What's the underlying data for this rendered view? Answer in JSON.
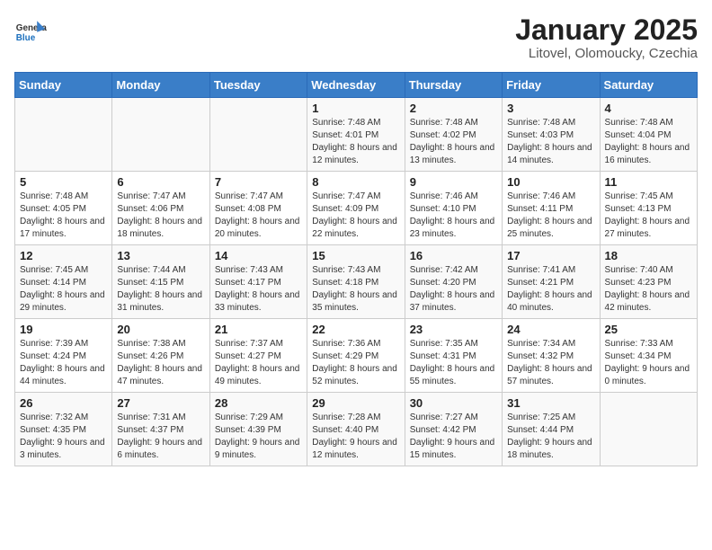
{
  "logo": {
    "general": "General",
    "blue": "Blue"
  },
  "title": "January 2025",
  "subtitle": "Litovel, Olomoucky, Czechia",
  "weekdays": [
    "Sunday",
    "Monday",
    "Tuesday",
    "Wednesday",
    "Thursday",
    "Friday",
    "Saturday"
  ],
  "weeks": [
    [
      {
        "day": "",
        "info": ""
      },
      {
        "day": "",
        "info": ""
      },
      {
        "day": "",
        "info": ""
      },
      {
        "day": "1",
        "info": "Sunrise: 7:48 AM\nSunset: 4:01 PM\nDaylight: 8 hours and 12 minutes."
      },
      {
        "day": "2",
        "info": "Sunrise: 7:48 AM\nSunset: 4:02 PM\nDaylight: 8 hours and 13 minutes."
      },
      {
        "day": "3",
        "info": "Sunrise: 7:48 AM\nSunset: 4:03 PM\nDaylight: 8 hours and 14 minutes."
      },
      {
        "day": "4",
        "info": "Sunrise: 7:48 AM\nSunset: 4:04 PM\nDaylight: 8 hours and 16 minutes."
      }
    ],
    [
      {
        "day": "5",
        "info": "Sunrise: 7:48 AM\nSunset: 4:05 PM\nDaylight: 8 hours and 17 minutes."
      },
      {
        "day": "6",
        "info": "Sunrise: 7:47 AM\nSunset: 4:06 PM\nDaylight: 8 hours and 18 minutes."
      },
      {
        "day": "7",
        "info": "Sunrise: 7:47 AM\nSunset: 4:08 PM\nDaylight: 8 hours and 20 minutes."
      },
      {
        "day": "8",
        "info": "Sunrise: 7:47 AM\nSunset: 4:09 PM\nDaylight: 8 hours and 22 minutes."
      },
      {
        "day": "9",
        "info": "Sunrise: 7:46 AM\nSunset: 4:10 PM\nDaylight: 8 hours and 23 minutes."
      },
      {
        "day": "10",
        "info": "Sunrise: 7:46 AM\nSunset: 4:11 PM\nDaylight: 8 hours and 25 minutes."
      },
      {
        "day": "11",
        "info": "Sunrise: 7:45 AM\nSunset: 4:13 PM\nDaylight: 8 hours and 27 minutes."
      }
    ],
    [
      {
        "day": "12",
        "info": "Sunrise: 7:45 AM\nSunset: 4:14 PM\nDaylight: 8 hours and 29 minutes."
      },
      {
        "day": "13",
        "info": "Sunrise: 7:44 AM\nSunset: 4:15 PM\nDaylight: 8 hours and 31 minutes."
      },
      {
        "day": "14",
        "info": "Sunrise: 7:43 AM\nSunset: 4:17 PM\nDaylight: 8 hours and 33 minutes."
      },
      {
        "day": "15",
        "info": "Sunrise: 7:43 AM\nSunset: 4:18 PM\nDaylight: 8 hours and 35 minutes."
      },
      {
        "day": "16",
        "info": "Sunrise: 7:42 AM\nSunset: 4:20 PM\nDaylight: 8 hours and 37 minutes."
      },
      {
        "day": "17",
        "info": "Sunrise: 7:41 AM\nSunset: 4:21 PM\nDaylight: 8 hours and 40 minutes."
      },
      {
        "day": "18",
        "info": "Sunrise: 7:40 AM\nSunset: 4:23 PM\nDaylight: 8 hours and 42 minutes."
      }
    ],
    [
      {
        "day": "19",
        "info": "Sunrise: 7:39 AM\nSunset: 4:24 PM\nDaylight: 8 hours and 44 minutes."
      },
      {
        "day": "20",
        "info": "Sunrise: 7:38 AM\nSunset: 4:26 PM\nDaylight: 8 hours and 47 minutes."
      },
      {
        "day": "21",
        "info": "Sunrise: 7:37 AM\nSunset: 4:27 PM\nDaylight: 8 hours and 49 minutes."
      },
      {
        "day": "22",
        "info": "Sunrise: 7:36 AM\nSunset: 4:29 PM\nDaylight: 8 hours and 52 minutes."
      },
      {
        "day": "23",
        "info": "Sunrise: 7:35 AM\nSunset: 4:31 PM\nDaylight: 8 hours and 55 minutes."
      },
      {
        "day": "24",
        "info": "Sunrise: 7:34 AM\nSunset: 4:32 PM\nDaylight: 8 hours and 57 minutes."
      },
      {
        "day": "25",
        "info": "Sunrise: 7:33 AM\nSunset: 4:34 PM\nDaylight: 9 hours and 0 minutes."
      }
    ],
    [
      {
        "day": "26",
        "info": "Sunrise: 7:32 AM\nSunset: 4:35 PM\nDaylight: 9 hours and 3 minutes."
      },
      {
        "day": "27",
        "info": "Sunrise: 7:31 AM\nSunset: 4:37 PM\nDaylight: 9 hours and 6 minutes."
      },
      {
        "day": "28",
        "info": "Sunrise: 7:29 AM\nSunset: 4:39 PM\nDaylight: 9 hours and 9 minutes."
      },
      {
        "day": "29",
        "info": "Sunrise: 7:28 AM\nSunset: 4:40 PM\nDaylight: 9 hours and 12 minutes."
      },
      {
        "day": "30",
        "info": "Sunrise: 7:27 AM\nSunset: 4:42 PM\nDaylight: 9 hours and 15 minutes."
      },
      {
        "day": "31",
        "info": "Sunrise: 7:25 AM\nSunset: 4:44 PM\nDaylight: 9 hours and 18 minutes."
      },
      {
        "day": "",
        "info": ""
      }
    ]
  ]
}
